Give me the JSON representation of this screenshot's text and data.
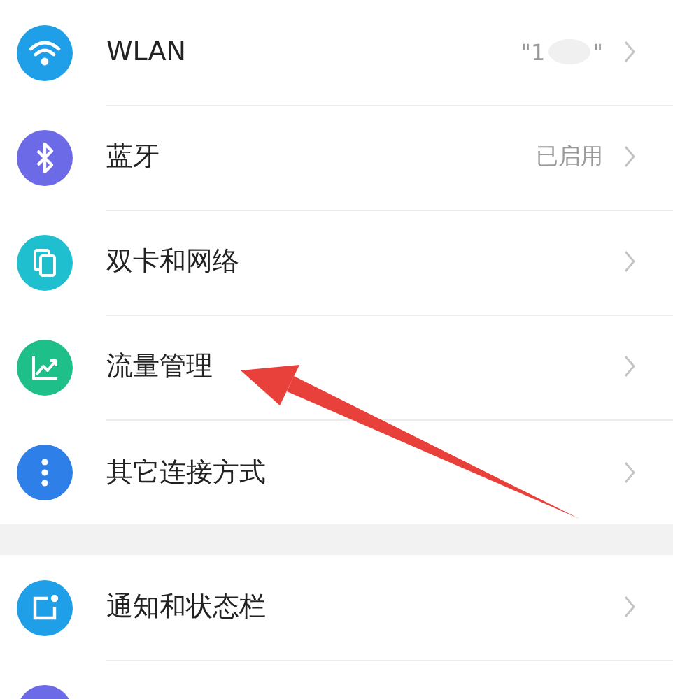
{
  "sections": [
    {
      "items": [
        {
          "label": "WLAN",
          "color": "#1e9fe8",
          "value": "\"1",
          "value_end": "\"",
          "blurred": true
        },
        {
          "label": "蓝牙",
          "color": "#6c6ae6",
          "value": "已启用"
        },
        {
          "label": "双卡和网络",
          "color": "#20bfcf"
        },
        {
          "label": "流量管理",
          "color": "#1fbf8a"
        },
        {
          "label": "其它连接方式",
          "color": "#2f7fe8"
        }
      ]
    },
    {
      "items": [
        {
          "label": "通知和状态栏",
          "color": "#1e9fe8"
        },
        {
          "color": "#6c6ae6"
        }
      ]
    }
  ],
  "annotation": {
    "kind": "arrow"
  }
}
